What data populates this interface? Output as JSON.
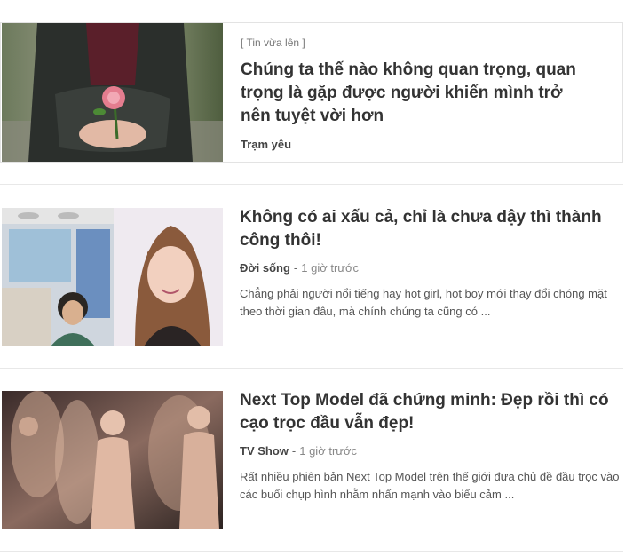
{
  "articles": [
    {
      "tag": "[ Tin vừa lên ]",
      "title": "Chúng ta thế nào không quan trọng, quan trọng là gặp được người khiến mình trở nên tuyệt vời hơn",
      "category": "Trạm yêu",
      "image": "woman-holding-pink-flower"
    },
    {
      "title": "Không có ai xấu cả, chỉ là chưa dậy thì thành công thôi!",
      "category": "Đời sống",
      "separator": "-",
      "time": "1 giờ trước",
      "description": "Chẳng phải người nổi tiếng hay hot girl, hot boy mới thay đổi chóng mặt theo thời gian đâu, mà chính chúng ta cũng có ...",
      "image": "before-after-girl-portraits"
    },
    {
      "title": "Next Top Model đã chứng minh: Đẹp rồi thì có cạo trọc đầu vẫn đẹp!",
      "category": "TV Show",
      "separator": "-",
      "time": "1 giờ trước",
      "description": "Rất nhiều phiên bản Next Top Model trên thế giới đưa chủ đề đầu trọc vào các buổi chụp hình nhằm nhấn mạnh vào biểu cảm ...",
      "image": "bald-models-photoshoot"
    }
  ]
}
